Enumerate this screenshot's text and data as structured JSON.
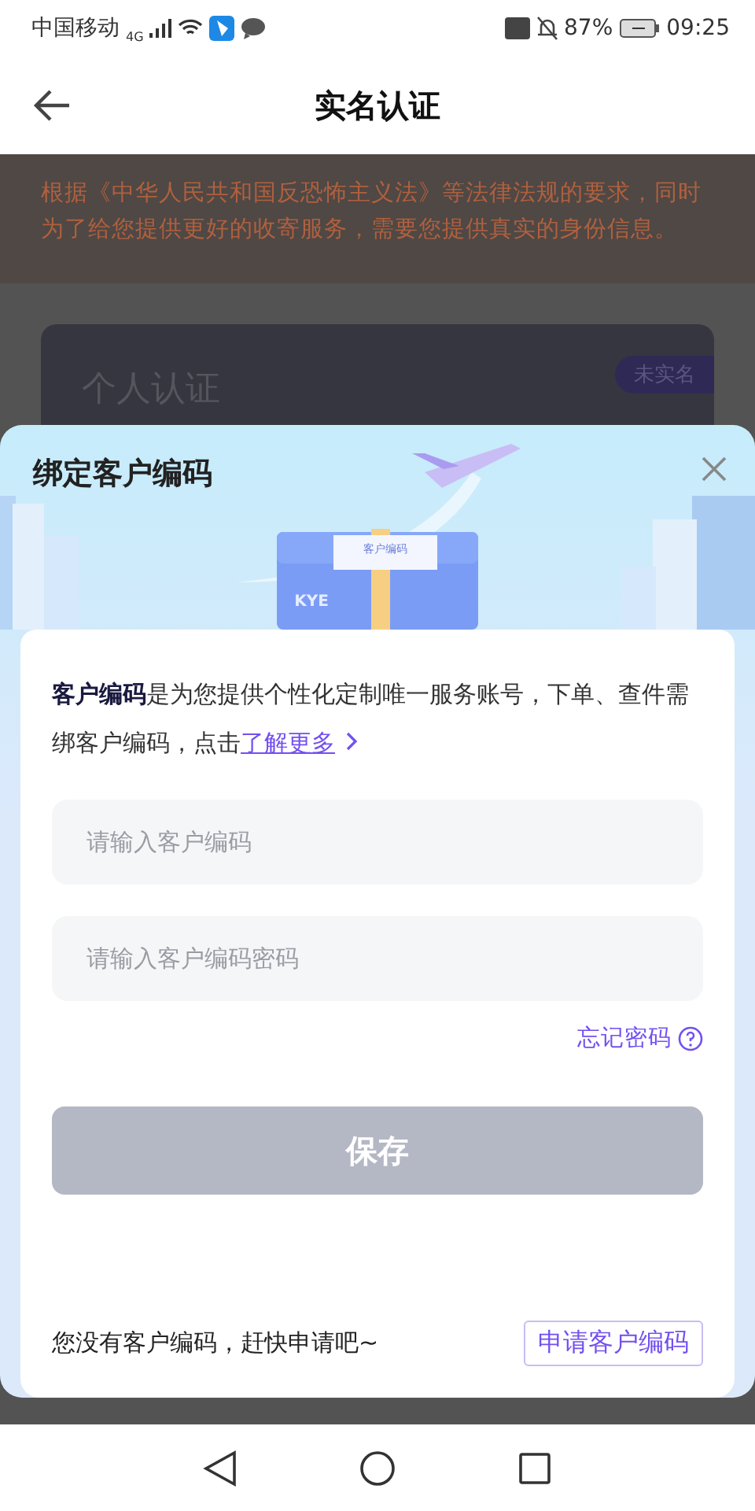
{
  "status_bar": {
    "carrier": "中国移动",
    "network": "4G",
    "battery": "87%",
    "time": "09:25"
  },
  "header": {
    "title": "实名认证"
  },
  "background": {
    "notice": "根据《中华人民共和国反恐怖主义法》等法律法规的要求，同时为了给您提供更好的收寄服务，需要您提供真实的身份信息。",
    "card_title": "个人认证",
    "badge": "未实名"
  },
  "dialog": {
    "title": "绑定客户编码",
    "box_label": "客户编码",
    "box_logo": "KYE",
    "description": "**客户编码**是为您提供个性化定制唯一服务账号，下单、查件需绑客户编码，点击",
    "learn_more": "了解更多",
    "fields": [
      {
        "placeholder": "请输入客户编码"
      },
      {
        "placeholder": "请输入客户编码密码"
      }
    ],
    "forgot_password": "忘记密码",
    "save": {
      "label": "保存",
      "disabled": true
    },
    "apply_prompt": "您没有客户编码，赶快申请吧~",
    "apply_button": "申请客户编码"
  }
}
